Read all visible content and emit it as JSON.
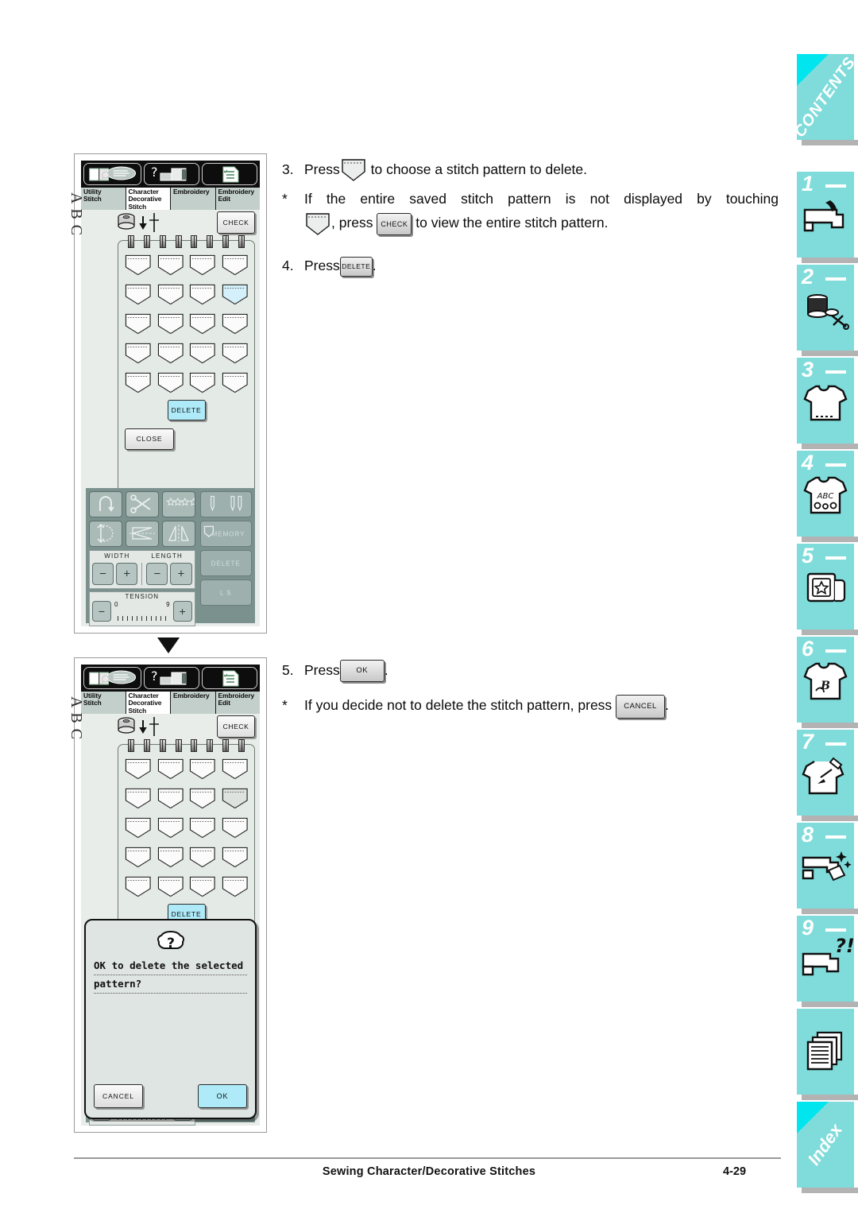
{
  "footer": {
    "title": "Sewing Character/Decorative Stitches",
    "page": "4-29"
  },
  "instructions": {
    "step3": {
      "marker": "3.",
      "before": "Press",
      "after": "to choose a stitch pattern to delete.",
      "pocket_icon": "pocket-icon"
    },
    "note1": {
      "marker": "*",
      "line1": "If the entire saved stitch pattern is not displayed by touching",
      "line2_a": ", press",
      "line2_b": "to view the entire stitch pattern.",
      "check_label": "CHECK",
      "pocket_icon": "pocket-icon"
    },
    "step4": {
      "marker": "4.",
      "before": "Press",
      "after": ".",
      "delete_label": "DELETE"
    },
    "step5": {
      "marker": "5.",
      "before": "Press",
      "after": ".",
      "ok_label": "OK"
    },
    "note2": {
      "marker": "*",
      "before": "If you decide not to delete the stitch pattern, press",
      "after": ".",
      "cancel_label": "CANCEL"
    }
  },
  "lcd": {
    "tabs": [
      {
        "label": "Utility\nStitch",
        "line1": "Utility",
        "line2": "Stitch",
        "line3": "",
        "active": false
      },
      {
        "label": "Character Decorative Stitch",
        "line1": "Character",
        "line2": "Decorative",
        "line3": "Stitch",
        "active": true
      },
      {
        "label": "Embroidery",
        "line1": "Embroidery",
        "line2": "",
        "line3": "",
        "active": false
      },
      {
        "label": "Embroidery Edit",
        "line1": "Embroidery",
        "line2": "Edit",
        "line3": "",
        "active": false
      }
    ],
    "header_icons": [
      "book-magnifier-icon",
      "question-machine-icon",
      "checklist-document-icon"
    ],
    "check_label": "CHECK",
    "abc_label": "ABC",
    "delete_label": "DELETE",
    "close_label": "CLOSE",
    "bobbin_icon": "bobbin-icon",
    "needle_down_icon": "needle-down-icon",
    "pocket_rows": 5,
    "pocket_cols": 4,
    "selected_pocket_index_panel1": 7,
    "selected_pocket_index_panel2": 7,
    "selected_color_panel1": "#d4f1fb",
    "selected_color_panel2": "#dde2df"
  },
  "controls": {
    "keys_left_row1": [
      "reverse-stitch-icon",
      "thread-cutter-icon",
      "stitch-preview-icon"
    ],
    "keys_left_row2": [
      "needle-position-icon",
      "mirror-horizontal-icon",
      "mirror-vertical-icon"
    ],
    "keys_right_row1": [
      "single-twin-needle-icon"
    ],
    "keys_right_row2": [
      "memory-icon"
    ],
    "memory_label": "MEMORY",
    "delete_label": "DELETE",
    "ls_label": "L  S",
    "width_label": "WIDTH",
    "length_label": "LENGTH",
    "tension_label": "TENSION",
    "tension_min": "0",
    "tension_max": "9",
    "minus_sign": "−",
    "plus_sign": "+"
  },
  "dialog": {
    "question_icon": "question-bubble-icon",
    "message_line1": "OK to delete the selected",
    "message_line2": "pattern?",
    "cancel_label": "CANCEL",
    "ok_label": "OK",
    "ok_color": "#aeeaf8"
  },
  "rail": {
    "contents_label": "CONTENTS",
    "index_label": "Index",
    "accent": "#7fdcda",
    "corner": "#00e5ee",
    "tabs": [
      {
        "num": "",
        "icon": "contents-tab",
        "word": "CONTENTS"
      },
      {
        "num": "1",
        "icon": "sewing-machine-icon",
        "word": ""
      },
      {
        "num": "2",
        "icon": "spool-scissors-icon",
        "word": ""
      },
      {
        "num": "3",
        "icon": "tshirt-icon",
        "word": ""
      },
      {
        "num": "4",
        "icon": "tshirt-abc-icon",
        "word": ""
      },
      {
        "num": "5",
        "icon": "embroidery-card-icon",
        "word": ""
      },
      {
        "num": "6",
        "icon": "tshirt-monogram-icon",
        "word": ""
      },
      {
        "num": "7",
        "icon": "tshirt-tools-icon",
        "word": ""
      },
      {
        "num": "8",
        "icon": "machine-sparkle-icon",
        "word": ""
      },
      {
        "num": "9",
        "icon": "machine-question-icon",
        "word": ""
      },
      {
        "num": "",
        "icon": "pages-icon",
        "word": ""
      },
      {
        "num": "",
        "icon": "index-tab",
        "word": "Index"
      }
    ]
  }
}
